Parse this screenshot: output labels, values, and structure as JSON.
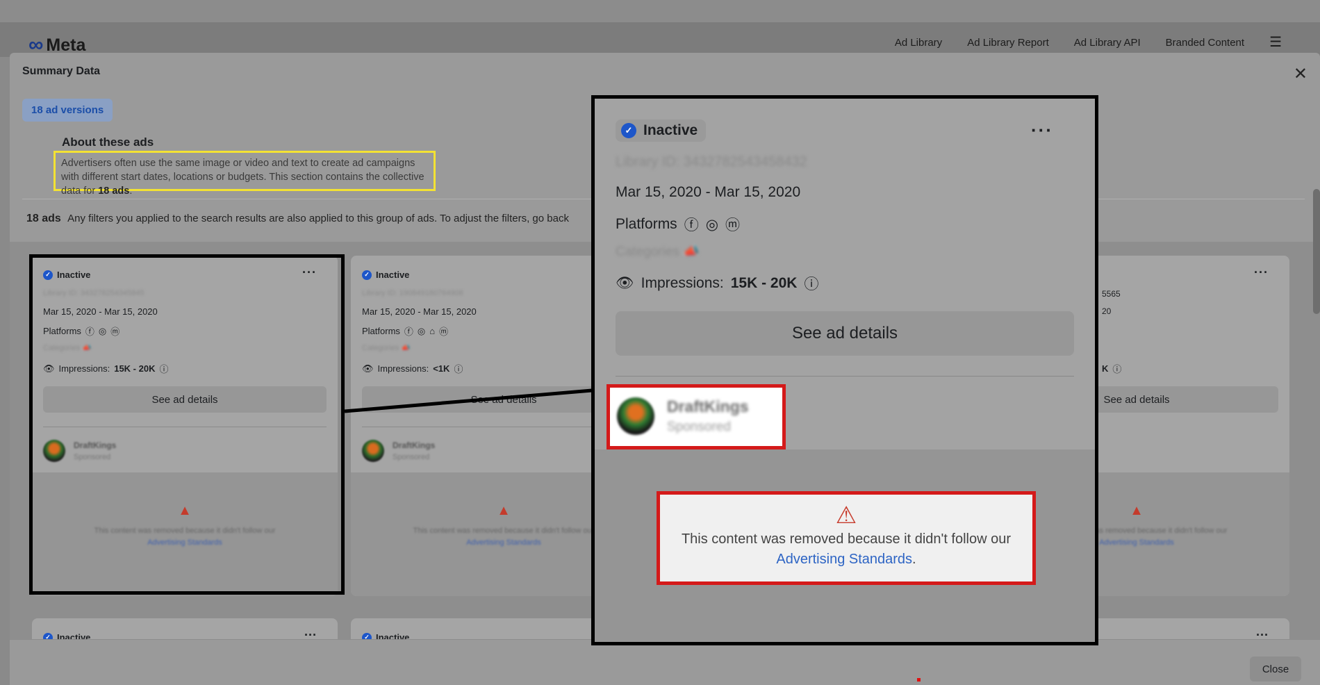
{
  "header": {
    "logo": "Meta",
    "nav": [
      "Ad Library",
      "Ad Library Report",
      "Ad Library API",
      "Branded Content"
    ]
  },
  "modal": {
    "title": "Summary Data",
    "versions_label": "18 ad versions",
    "about_title": "About these ads",
    "about_text": "Advertisers often use the same image or video and text to create ad campaigns with different start dates, locations or budgets. This section contains the collective data for",
    "about_count": "18 ads",
    "ads_count": "18 ads",
    "ads_note": "Any filters you applied to the search results are also applied to this group of ads. To adjust the filters, go back",
    "close_label": "Close"
  },
  "cards": [
    {
      "status": "Inactive",
      "library_id": "Library ID: 343278254345845",
      "date": "Mar 15, 2020 - Mar 15, 2020",
      "platforms_label": "Platforms",
      "categories_label": "Categories",
      "impressions_label": "Impressions:",
      "impressions_value": "15K - 20K",
      "button": "See ad details",
      "advertiser": "DraftKings",
      "sponsored": "Sponsored",
      "removed_text": "This content was removed because it didn't follow our",
      "removed_link": "Advertising Standards"
    },
    {
      "status": "Inactive",
      "library_id": "Library ID: 190849180764908",
      "date": "Mar 15, 2020 - Mar 15, 2020",
      "platforms_label": "Platforms",
      "categories_label": "Categories",
      "impressions_label": "Impressions:",
      "impressions_value": "<1K",
      "button": "See ad details",
      "advertiser": "DraftKings",
      "sponsored": "Sponsored",
      "removed_text": "This content was removed because it didn't follow our",
      "removed_link": "Advertising Standards"
    },
    {
      "status": "Inactive",
      "library_id": "5565",
      "date": "20",
      "impressions_value": "K",
      "button": "See ad details",
      "removed_text": "This content was removed because it didn't follow our",
      "removed_link": "Advertising Standards"
    }
  ],
  "row2": [
    {
      "status": "Inactive"
    },
    {
      "status": "Inactive"
    }
  ],
  "zoom": {
    "status": "Inactive",
    "library_id": "Library ID: 3432782543458432",
    "date": "Mar 15, 2020 - Mar 15, 2020",
    "platforms_label": "Platforms",
    "categories_label": "Categories",
    "impressions_label": "Impressions:",
    "impressions_value": "15K - 20K",
    "button": "See ad details",
    "advertiser": "DraftKings",
    "sponsored": "Sponsored",
    "removed_text": "This content was removed because it didn't follow our",
    "removed_link": "Advertising Standards",
    "removed_period": "."
  },
  "colors": {
    "highlight_yellow": "#f3e233",
    "highlight_red": "#d41a1a",
    "link_blue": "#2d64c4",
    "badge_blue": "#1d56c9"
  }
}
